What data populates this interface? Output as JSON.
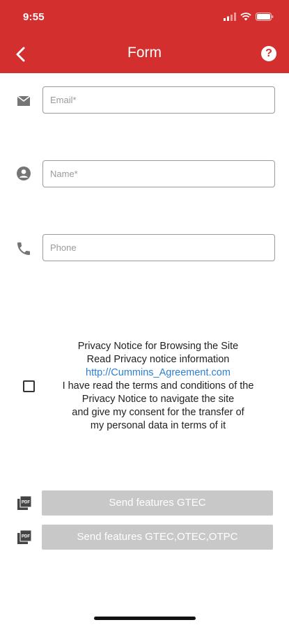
{
  "status_bar": {
    "time": "9:55",
    "icons": [
      "signal-icon",
      "wifi-icon",
      "battery-icon"
    ]
  },
  "header": {
    "title": "Form",
    "back_icon": "back-arrow-icon",
    "help_label": "?"
  },
  "form": {
    "email": {
      "placeholder": "Email*",
      "value": "",
      "icon": "mail-icon"
    },
    "name": {
      "placeholder": "Name*",
      "value": "",
      "icon": "person-icon"
    },
    "phone": {
      "placeholder": "Phone",
      "value": "",
      "icon": "phone-icon"
    }
  },
  "privacy": {
    "checked": false,
    "line1": "Privacy Notice for Browsing the Site",
    "line2": "Read Privacy notice information",
    "link": "http://Cummins_Agreement.com",
    "line3": "I have read the terms and conditions of the",
    "line4": "Privacy Notice to navigate the site",
    "line5": "and give my consent for the transfer of",
    "line6": "my personal data in terms of it"
  },
  "actions": {
    "pdf_icon_label": "PDF",
    "button1": "Send features GTEC",
    "button2": "Send features GTEC,OTEC,OTPC"
  },
  "colors": {
    "header": "#d32f2f",
    "link": "#2a7fd4",
    "button_disabled": "#c8c8c8"
  }
}
